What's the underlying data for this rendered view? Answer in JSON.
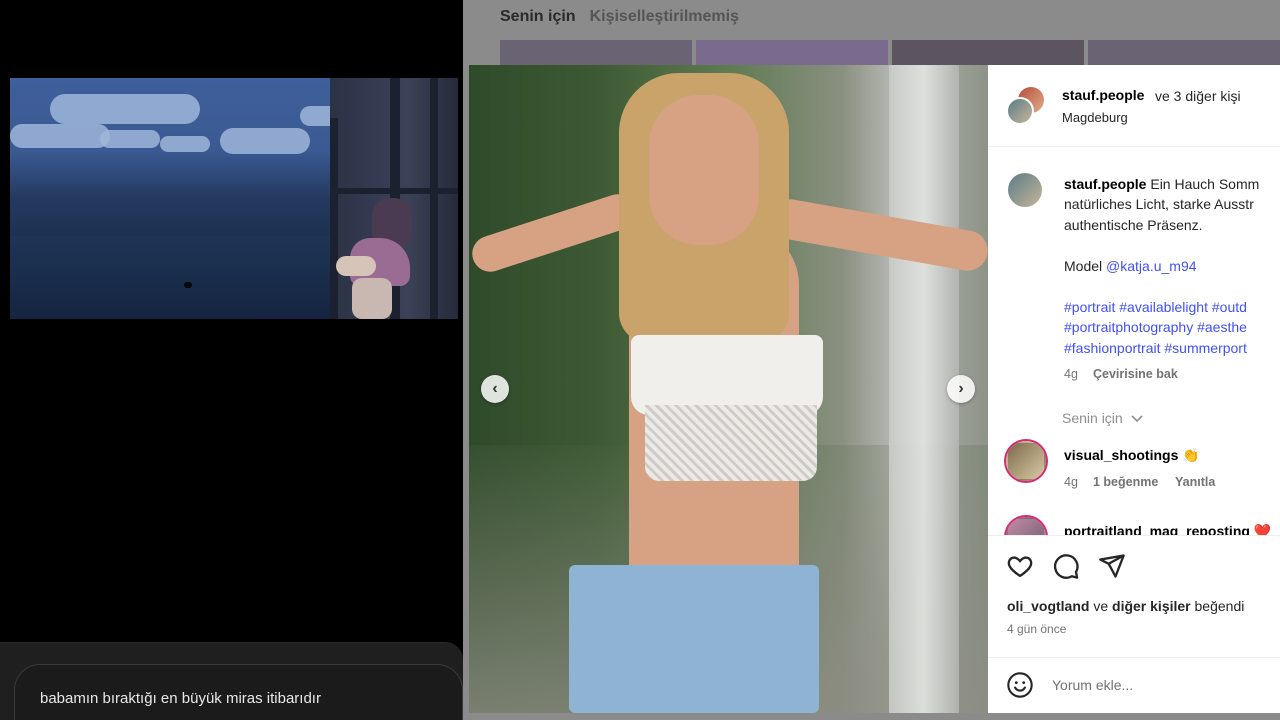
{
  "background_feed": {
    "tabs": [
      {
        "label": "Senin için",
        "active": true
      },
      {
        "label": "Kişiselleştirilmemiş",
        "active": false
      }
    ]
  },
  "video_overlay": {
    "chat_message": "babamın bıraktığı en büyük miras itibarıdır"
  },
  "post": {
    "header": {
      "username": "stauf.people",
      "collab_text": "ve 3 diğer kişi",
      "location": "Magdeburg"
    },
    "caption": {
      "username": "stauf.people",
      "lines": [
        "Ein Hauch Somm",
        "natürliches Licht, starke Ausstr",
        "authentische Präsenz."
      ],
      "model_label": "Model",
      "model_mention": "@katja.u_m94",
      "hashtag_lines": [
        "#portrait #availablelight #outd",
        "#portraitphotography #aesthe",
        "#fashionportrait #summerport"
      ],
      "age": "4g",
      "translate": "Çevirisine bak"
    },
    "comments_filter": "Senin için",
    "comments": [
      {
        "username": "visual_shootings",
        "emoji": "👏",
        "age": "4g",
        "likes": "1 beğenme",
        "reply": "Yanıtla"
      },
      {
        "username": "portraitland_mag_reposting",
        "emoji": "❤️"
      }
    ],
    "likes_summary": {
      "user": "oli_vogtland",
      "connector": "ve",
      "others": "diğer kişiler",
      "suffix": "beğendi"
    },
    "time_ago": "4 gün önce",
    "comment_placeholder": "Yorum ekle..."
  },
  "icons": [
    "chevron-left-icon",
    "chevron-right-icon",
    "heart-icon",
    "comment-icon",
    "share-icon",
    "emoji-icon",
    "chevron-down-icon"
  ],
  "colors": {
    "link": "#4150f7",
    "story_ring": "#d62976"
  }
}
